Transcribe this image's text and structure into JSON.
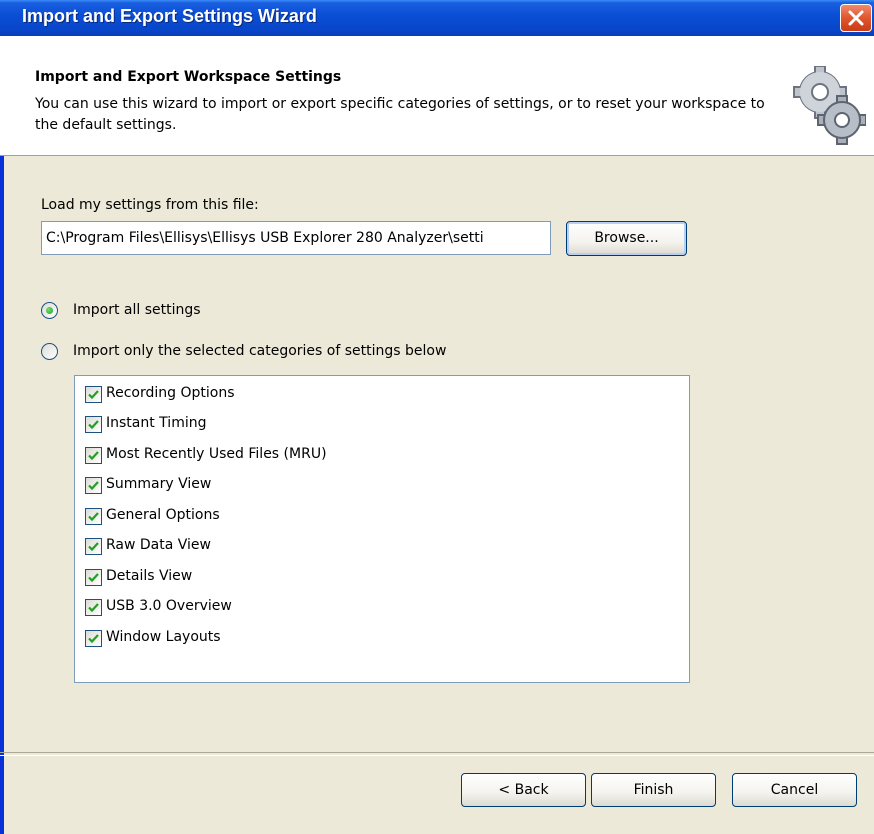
{
  "window": {
    "title": "Import and Export Settings Wizard"
  },
  "header": {
    "title": "Import and Export Workspace Settings",
    "description": "You can use this wizard to import or export specific categories of settings, or to reset your workspace to the default settings."
  },
  "load": {
    "label": "Load my settings from this file:",
    "path_value": "C:\\Program Files\\Ellisys\\Ellisys USB Explorer 280 Analyzer\\setti",
    "browse_label": "Browse..."
  },
  "options": {
    "import_all_label": "Import all settings",
    "import_selected_label": "Import only the selected categories of settings below",
    "selected": "import_all"
  },
  "categories": [
    {
      "label": "Recording Options",
      "checked": true
    },
    {
      "label": "Instant Timing",
      "checked": true
    },
    {
      "label": "Most Recently Used Files (MRU)",
      "checked": true
    },
    {
      "label": "Summary View",
      "checked": true
    },
    {
      "label": "General Options",
      "checked": true
    },
    {
      "label": "Raw Data View",
      "checked": true
    },
    {
      "label": "Details View",
      "checked": true
    },
    {
      "label": "USB 3.0 Overview",
      "checked": true
    },
    {
      "label": "Window Layouts",
      "checked": true
    }
  ],
  "buttons": {
    "back": "< Back",
    "finish": "Finish",
    "cancel": "Cancel"
  },
  "colors": {
    "titlebar": "#0a4fd6",
    "close": "#e0552e",
    "check": "#21a121"
  }
}
